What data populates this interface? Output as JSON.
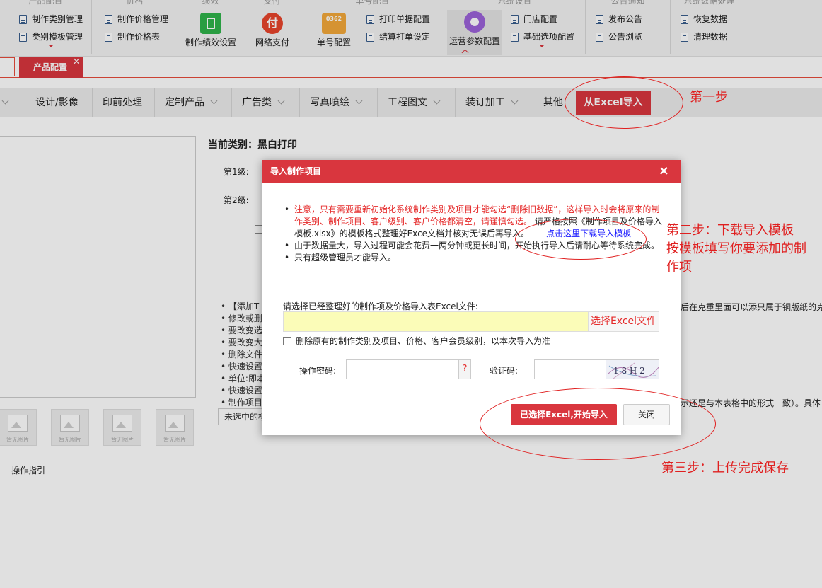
{
  "ribbon": {
    "groups": [
      {
        "title": "产品配置",
        "items": [
          "制作类别管理",
          "类别模板管理"
        ]
      },
      {
        "title": "价格",
        "items": [
          "制作价格管理",
          "制作价格表"
        ]
      },
      {
        "title": "绩效",
        "big": "制作绩效设置"
      },
      {
        "title": "支付",
        "big": "网络支付"
      },
      {
        "title": "单号配置",
        "big": "单号配置",
        "badge": "0362",
        "items": [
          "打印单据配置",
          "结算打单设定"
        ]
      },
      {
        "title": "系统设置",
        "big": "运营参数配置",
        "items": [
          "门店配置",
          "基础选项配置"
        ]
      },
      {
        "title": "公告通知",
        "items": [
          "发布公告",
          "公告浏览"
        ]
      },
      {
        "title": "系统数据处理",
        "items": [
          "恢复数据",
          "清理数据"
        ]
      }
    ],
    "pay_icon_text": "付"
  },
  "tabs": {
    "active_label": "产品配置",
    "close_glyph": "×"
  },
  "categories": [
    "设计/影像",
    "印前处理",
    "定制产品",
    "广告类",
    "写真喷绘",
    "工程图文",
    "装订加工",
    "其他"
  ],
  "category_excel": "从Excel导入",
  "content": {
    "current_category": "当前类别：黑白打印",
    "level1": "第1级:",
    "level2": "第2级:",
    "bullets": [
      "【添加T",
      "修改或删",
      "要改变选",
      "要改变大",
      "删除文件",
      "快速设置",
      "单位:即本",
      "快速设置",
      "制作项目"
    ],
    "right_text_1": "后在克重里面可以添只属于铜版纸的克重",
    "right_text_2": "示还是与本表格中的形式一致）。具体",
    "select_placeholder": "未选中的模",
    "thumb_caption": "暂无图片",
    "guide": "操作指引"
  },
  "modal": {
    "title": "导入制作项目",
    "close": "×",
    "note1_red": "注意，只有需要重新初始化系统制作类别及项目才能勾选“删除旧数据”，这样导入时会将原来的制作类别、制作项目、客户级别、客户价格都清空，请谨慎勾选。",
    "note1_black": "请严格按照《制作项目及价格导入模板.xlsx》的模板格式整理好Exce文档并核对无误后再导入。",
    "note1_link": "点击这里下载导入模板",
    "note2": "由于数据量大，导入过程可能会花费一两分钟或更长时间，开始执行导入后请耐心等待系统完成。",
    "note3": "只有超级管理员才能导入。",
    "select_prompt": "请选择已经整理好的制作项及价格导入表Excel文件:",
    "file_button": "选择Excel文件",
    "delete_label": "删除原有的制作类别及项目、价格、客户会员级别，以本次导入为准",
    "password_label": "操作密码:",
    "password_help": "?",
    "verify_label": "验证码:",
    "captcha_text": "1 8 H 2",
    "import_button": "已选择Excel,开始导入",
    "close_button": "关闭"
  },
  "annotations": {
    "step1": "第一步",
    "step2_line1": "第二步：下载导入模板",
    "step2_line2": "按模板填写你要添加的制",
    "step2_line3": "作项",
    "step3": "第三步：上传完成保存"
  },
  "colors": {
    "accent": "#d9363e",
    "annotation": "#e02020",
    "file_box": "#fbfcb8",
    "link": "#1a1aff"
  }
}
